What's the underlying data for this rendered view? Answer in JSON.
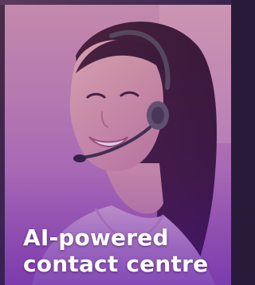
{
  "card": {
    "caption_line1": "AI-powered",
    "caption_line2": "contact centre"
  },
  "colors": {
    "overlay_top": "#c98fb1",
    "overlay_bottom": "#7f3fbe",
    "caption_text": "#ffffff"
  }
}
